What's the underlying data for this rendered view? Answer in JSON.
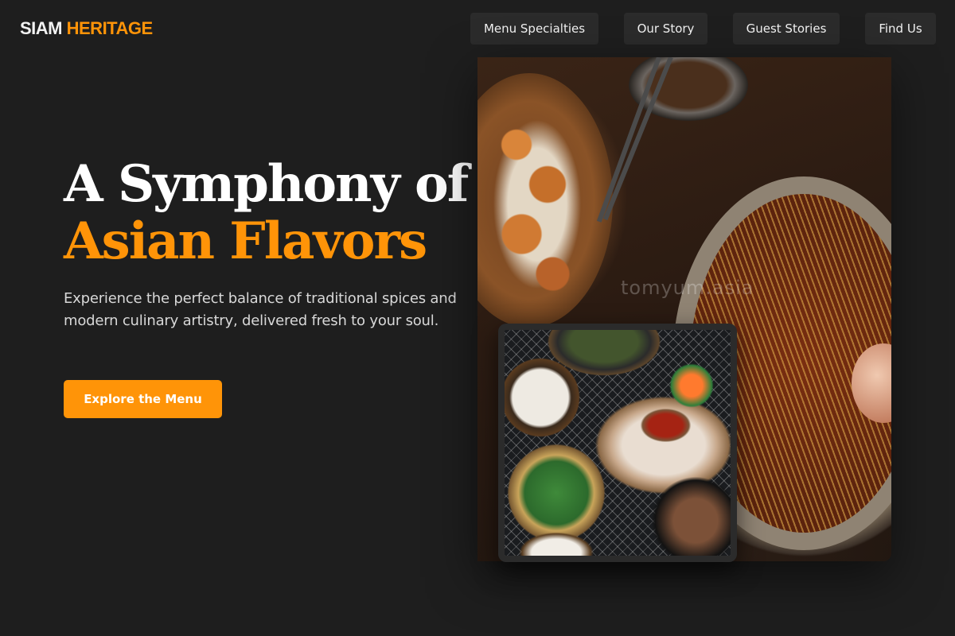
{
  "brand": {
    "name_part1": "SIAM",
    "name_part2": "HERITAGE"
  },
  "nav": {
    "items": [
      {
        "label": "Menu Specialties"
      },
      {
        "label": "Our Story"
      },
      {
        "label": "Guest Stories"
      },
      {
        "label": "Find Us"
      }
    ]
  },
  "hero": {
    "title_line1": "A Symphony of",
    "title_line2": "Asian Flavors",
    "subtitle": "Experience the perfect balance of traditional spices and modern culinary artistry, delivered fresh to your soul.",
    "cta_label": "Explore the Menu"
  },
  "images": {
    "main": {
      "watermark": "tomyum.asia"
    }
  },
  "colors": {
    "accent": "#ff9408",
    "background": "#1e1e1e",
    "nav_button_bg": "#2b2b2b"
  }
}
